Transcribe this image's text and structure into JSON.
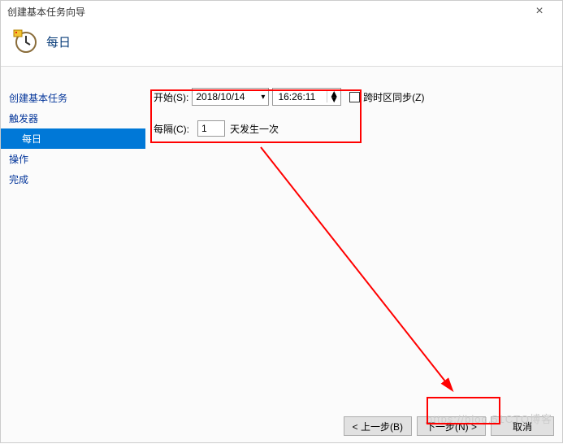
{
  "title": "创建基本任务向导",
  "header": {
    "title": "每日"
  },
  "sidebar": {
    "items": [
      {
        "label": "创建基本任务"
      },
      {
        "label": "触发器"
      },
      {
        "label": "每日",
        "sub": true,
        "selected": true
      },
      {
        "label": "操作"
      },
      {
        "label": "完成"
      }
    ]
  },
  "form": {
    "start_label": "开始(S):",
    "date_value": "2018/10/14",
    "time_value": "16:26:11",
    "sync_label": "跨时区同步(Z)",
    "interval_label": "每隔(C):",
    "interval_value": "1",
    "interval_suffix": "天发生一次"
  },
  "footer": {
    "back": "< 上一步(B)",
    "next": "下一步(N) >",
    "cancel": "取消"
  },
  "watermark": "https://blog.51CTO博客"
}
